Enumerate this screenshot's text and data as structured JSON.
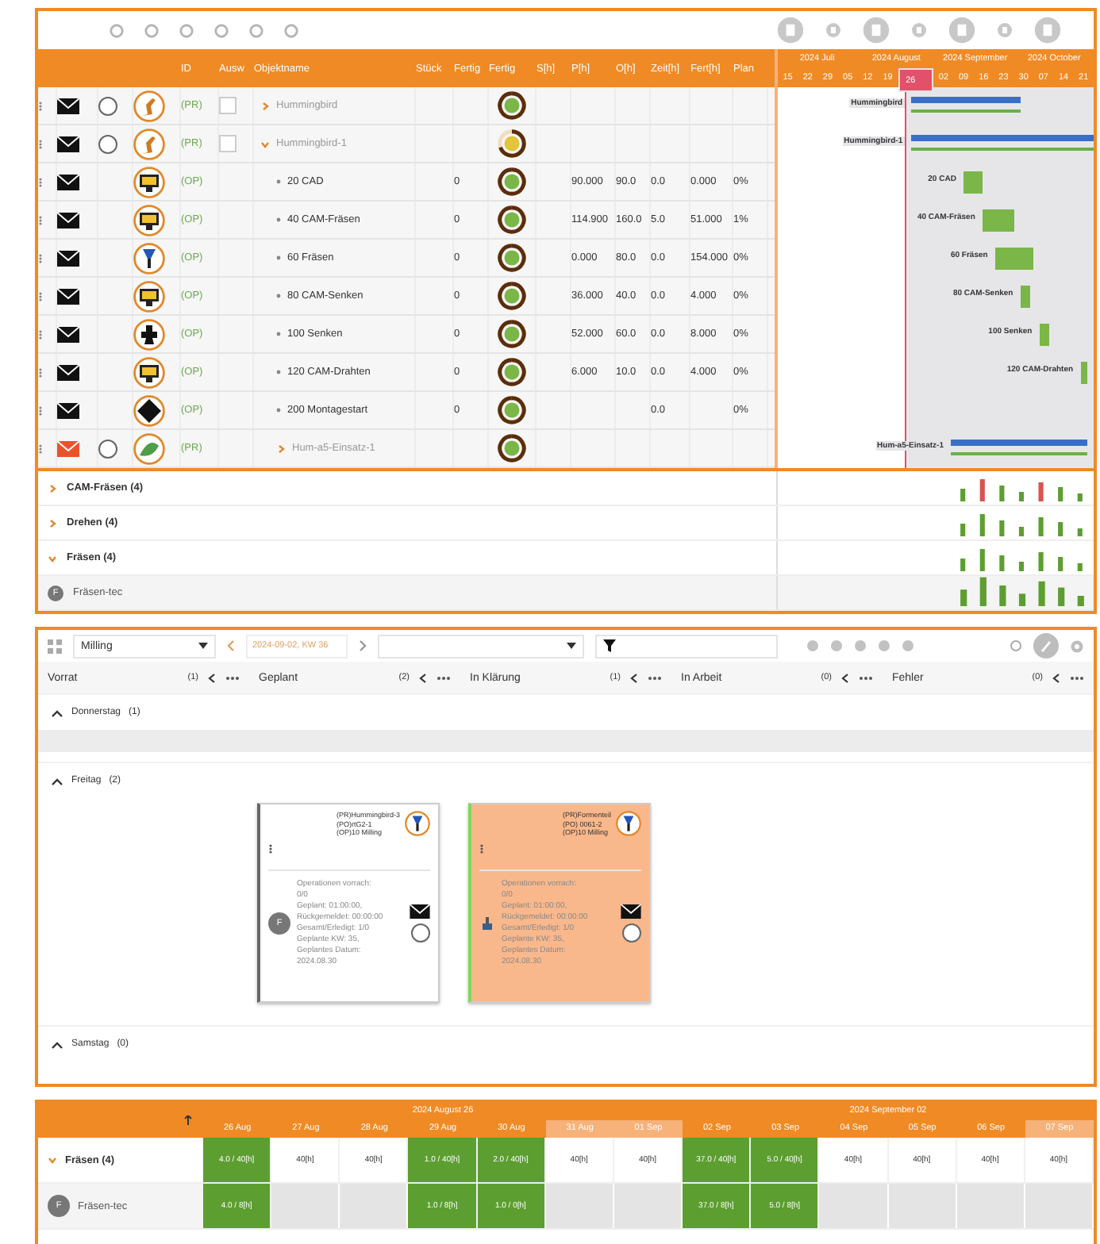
{
  "planning_table": {
    "columns": [
      "ID",
      "Ausw",
      "Objektname",
      "Stück",
      "Fertig",
      "Fertig",
      "S[h]",
      "P[h]",
      "O[h]",
      "Zeit[h]",
      "Fert[h]",
      "Plan"
    ],
    "rows": [
      {
        "kind": "project",
        "id": "(PR)",
        "name": "Hummingbird",
        "flagged": false,
        "expanded": false,
        "radio": {
          "selected": false
        },
        "select": {
          "checked": false
        },
        "complete": true,
        "gantt_label": "Hummingbird"
      },
      {
        "kind": "project",
        "id": "(PR)",
        "name": "Hummingbird-1",
        "flagged": false,
        "expanded": true,
        "radio": {
          "selected": false
        },
        "select": {
          "checked": false
        },
        "complete": false,
        "gantt_label": "Hummingbird-1",
        "children": [
          {
            "kind": "operation",
            "id": "(OP)",
            "name": "20 CAD",
            "flagged": false,
            "complete": true,
            "values": {
              "fertig": "0",
              "p": "90.000",
              "o": "90.0",
              "zeit": "0.0",
              "fert": "0.000",
              "plan": "0%"
            },
            "gantt_label": "20 CAD"
          },
          {
            "kind": "operation",
            "id": "(OP)",
            "name": "40 CAM-Fräsen",
            "flagged": false,
            "complete": true,
            "values": {
              "fertig": "0",
              "p": "114.900",
              "o": "160.0",
              "zeit": "5.0",
              "fert": "51.000",
              "plan": "1%"
            },
            "gantt_label": "40 CAM-Fräsen"
          },
          {
            "kind": "operation",
            "id": "(OP)",
            "name": "60 Fräsen",
            "flagged": false,
            "complete": true,
            "values": {
              "fertig": "0",
              "p": "0.000",
              "o": "80.0",
              "zeit": "0.0",
              "fert": "154.000",
              "plan": "0%"
            },
            "gantt_label": "60 Fräsen"
          },
          {
            "kind": "operation",
            "id": "(OP)",
            "name": "80 CAM-Senken",
            "flagged": false,
            "complete": true,
            "values": {
              "fertig": "0",
              "p": "36.000",
              "o": "40.0",
              "zeit": "0.0",
              "fert": "4.000",
              "plan": "0%"
            },
            "gantt_label": "80 CAM-Senken"
          },
          {
            "kind": "operation",
            "id": "(OP)",
            "name": "100 Senken",
            "flagged": false,
            "complete": true,
            "values": {
              "fertig": "0",
              "p": "52.000",
              "o": "60.0",
              "zeit": "0.0",
              "fert": "8.000",
              "plan": "0%"
            },
            "gantt_label": "100 Senken"
          },
          {
            "kind": "operation",
            "id": "(OP)",
            "name": "120 CAM-Drahten",
            "flagged": false,
            "complete": true,
            "values": {
              "fertig": "0",
              "p": "6.000",
              "o": "10.0",
              "zeit": "0.0",
              "fert": "4.000",
              "plan": "0%"
            },
            "gantt_label": "120 CAM-Drahten"
          },
          {
            "kind": "operation",
            "id": "(OP)",
            "name": "200 Montagestart",
            "flagged": false,
            "complete": true,
            "values": {
              "fertig": "0",
              "zeit": "0.0",
              "plan": "0%"
            }
          },
          {
            "kind": "project",
            "id": "(PR)",
            "name": "Hum-a5-Einsatz-1",
            "flagged": true,
            "expanded": false,
            "radio": {
              "selected": false
            },
            "complete": true,
            "gantt_label": "Hum-a5-Einsatz-1"
          }
        ]
      }
    ]
  },
  "gantt": {
    "months": [
      "2024 Juli",
      "2024 August",
      "2024 September",
      "2024 October"
    ],
    "weeks": [
      {
        "label": "15",
        "selected": false
      },
      {
        "label": "22",
        "selected": false
      },
      {
        "label": "29",
        "selected": false
      },
      {
        "label": "05",
        "selected": false
      },
      {
        "label": "12",
        "selected": false
      },
      {
        "label": "19",
        "selected": false
      },
      {
        "label": "26",
        "selected": true
      },
      {
        "label": "02",
        "selected": false
      },
      {
        "label": "09",
        "selected": false
      },
      {
        "label": "16",
        "selected": false
      },
      {
        "label": "23",
        "selected": false
      },
      {
        "label": "30",
        "selected": false
      },
      {
        "label": "07",
        "selected": false
      },
      {
        "label": "14",
        "selected": false
      },
      {
        "label": "21",
        "selected": false
      }
    ]
  },
  "resources": {
    "groups": [
      {
        "name": "CAM-Fräsen (4)",
        "expanded": false
      },
      {
        "name": "Drehen (4)",
        "expanded": false
      },
      {
        "name": "Fräsen (4)",
        "expanded": true,
        "children": [
          {
            "avatar": "F",
            "name": "Fräsen-tec"
          }
        ]
      }
    ]
  },
  "board": {
    "toolbar": {
      "view": "Milling",
      "date": "2024-09-02, KW 36"
    },
    "columns": [
      {
        "kind": "stock",
        "title": "Vorrat",
        "count": "(1)"
      },
      {
        "kind": "planned",
        "title": "Geplant",
        "count": "(2)"
      },
      {
        "kind": "clarify",
        "title": "In Klärung",
        "count": "(1)"
      },
      {
        "kind": "working",
        "title": "In Arbeit",
        "count": "(0)"
      },
      {
        "kind": "error",
        "title": "Fehler",
        "count": "(0)"
      }
    ],
    "day_groups": [
      {
        "label": "Donnerstag",
        "count": "(1)",
        "expanded": true
      },
      {
        "label": "Freitag",
        "count": "(2)",
        "expanded": true,
        "cards": [
          {
            "kind": "planned",
            "color": "#ffffff",
            "refs": [
              "(PR)Hummingbird-3",
              "(PO)rtG2-1",
              "(OP)10 Milling"
            ],
            "avatar": "F",
            "details": [
              "Operationen vorrach:",
              "0/0",
              "Geplant: 01:00:00,",
              "Rückgemeldet: 00:00:00",
              "Gesamt/Erledigt: 1/0",
              "Geplante KW: 35,",
              "Geplantes Datum:",
              "2024.08.30"
            ]
          },
          {
            "kind": "clarify",
            "color": "#f9b88c",
            "refs": [
              "(PR)Formenteil",
              "(PO) 0061-2",
              "(OP)10 Milling"
            ],
            "details": [
              "Operationen vorrach:",
              "0/0",
              "Geplant: 01:00:00,",
              "Rückgemeldet: 00:00:00",
              "Gesamt/Erledigt: 1/0",
              "Geplante KW: 35,",
              "Geplantes Datum:",
              "2024.08.30"
            ]
          }
        ]
      },
      {
        "label": "Samstag",
        "count": "(0)",
        "expanded": true
      }
    ]
  },
  "capacity": {
    "weeks": [
      "2024 August 26",
      "2024 September 02"
    ],
    "days": [
      {
        "label": "26 Aug",
        "weekend": false
      },
      {
        "label": "27 Aug",
        "weekend": false
      },
      {
        "label": "28 Aug",
        "weekend": false
      },
      {
        "label": "29 Aug",
        "weekend": false
      },
      {
        "label": "30 Aug",
        "weekend": false
      },
      {
        "label": "31 Aug",
        "weekend": true
      },
      {
        "label": "01 Sep",
        "weekend": true
      },
      {
        "label": "02 Sep",
        "weekend": false
      },
      {
        "label": "03 Sep",
        "weekend": false
      },
      {
        "label": "04 Sep",
        "weekend": false
      },
      {
        "label": "05 Sep",
        "weekend": false
      },
      {
        "label": "06 Sep",
        "weekend": false
      },
      {
        "label": "07 Sep",
        "weekend": true
      }
    ],
    "rows": [
      {
        "name": "Fräsen (4)",
        "expanded": true,
        "cells": [
          {
            "text": "4.0 / 40[h]",
            "booked": true
          },
          {
            "text": "40[h]",
            "booked": false
          },
          {
            "text": "40[h]",
            "booked": false
          },
          {
            "text": "1.0 / 40[h]",
            "booked": true
          },
          {
            "text": "2.0 / 40[h]",
            "booked": true
          },
          {
            "text": "40[h]",
            "booked": false
          },
          {
            "text": "40[h]",
            "booked": false
          },
          {
            "text": "37.0 / 40[h]",
            "booked": true
          },
          {
            "text": "5.0 / 40[h]",
            "booked": true
          },
          {
            "text": "40[h]",
            "booked": false
          },
          {
            "text": "40[h]",
            "booked": false
          },
          {
            "text": "40[h]",
            "booked": false
          },
          {
            "text": "40[h]",
            "booked": false
          }
        ]
      },
      {
        "name": "Fräsen-tec",
        "avatar": "F",
        "cells": [
          {
            "text": "4.0 / 8[h]",
            "booked": true
          },
          {
            "booked": false
          },
          {
            "booked": false
          },
          {
            "text": "1.0 / 8[h]",
            "booked": true
          },
          {
            "text": "1.0 / 0[h]",
            "booked": true
          },
          {
            "booked": false
          },
          {
            "booked": false
          },
          {
            "text": "37.0 / 8[h]",
            "booked": true
          },
          {
            "text": "5.0 / 8[h]",
            "booked": true
          },
          {
            "booked": false
          },
          {
            "booked": false
          },
          {
            "booked": false
          },
          {
            "booked": false
          }
        ]
      }
    ]
  }
}
